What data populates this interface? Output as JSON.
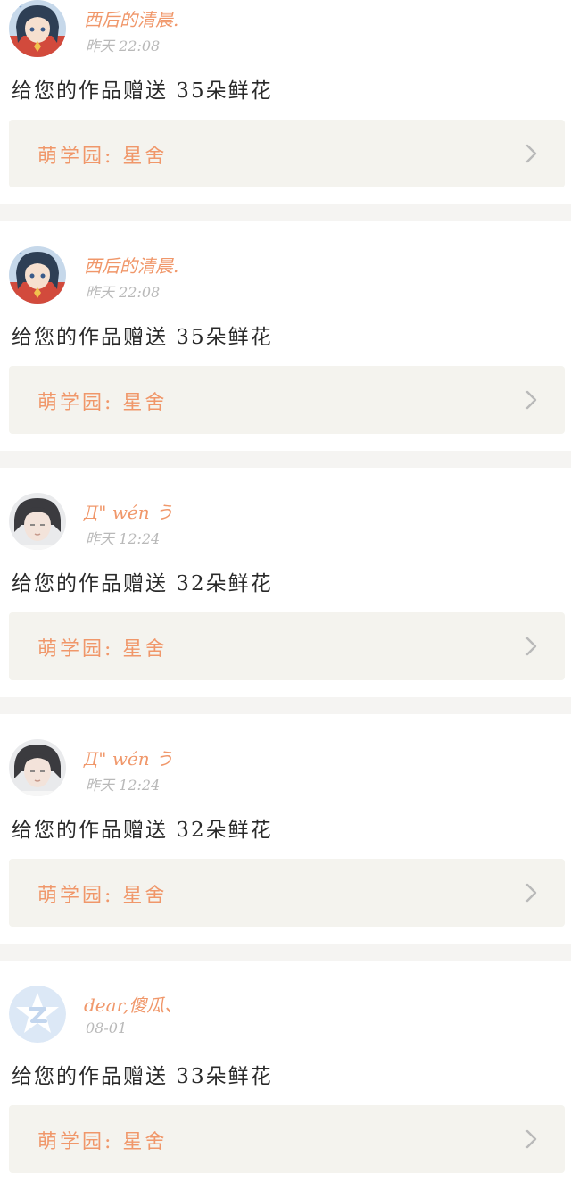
{
  "feed": {
    "items": [
      {
        "user": "西后的清晨.",
        "time": "昨天 22:08",
        "avatar": "anime-girl-avatar",
        "message": "给您的作品赠送 35朵鲜花",
        "work_label": "萌学园: 星舍"
      },
      {
        "user": "西后的清晨.",
        "time": "昨天 22:08",
        "avatar": "anime-girl-avatar",
        "message": "给您的作品赠送 35朵鲜花",
        "work_label": "萌学园: 星舍"
      },
      {
        "user": "Д\" wén う",
        "time": "昨天 12:24",
        "avatar": "photo-portrait-avatar",
        "message": "给您的作品赠送 32朵鲜花",
        "work_label": "萌学园: 星舍"
      },
      {
        "user": "Д\" wén う",
        "time": "昨天 12:24",
        "avatar": "photo-portrait-avatar",
        "message": "给您的作品赠送 32朵鲜花",
        "work_label": "萌学园: 星舍"
      },
      {
        "user": "dear,傻瓜、",
        "time": "08-01",
        "avatar": "qq-default-avatar",
        "message": "给您的作品赠送 33朵鲜花",
        "work_label": "萌学园: 星舍"
      }
    ]
  },
  "icons": {
    "chevron": "chevron-right-icon"
  },
  "colors": {
    "accent": "#f0976a",
    "timestamp": "#b9b9b9",
    "message": "#2a2a2a",
    "link_background": "#f4f3ee",
    "separator": "#f5f4f2"
  }
}
